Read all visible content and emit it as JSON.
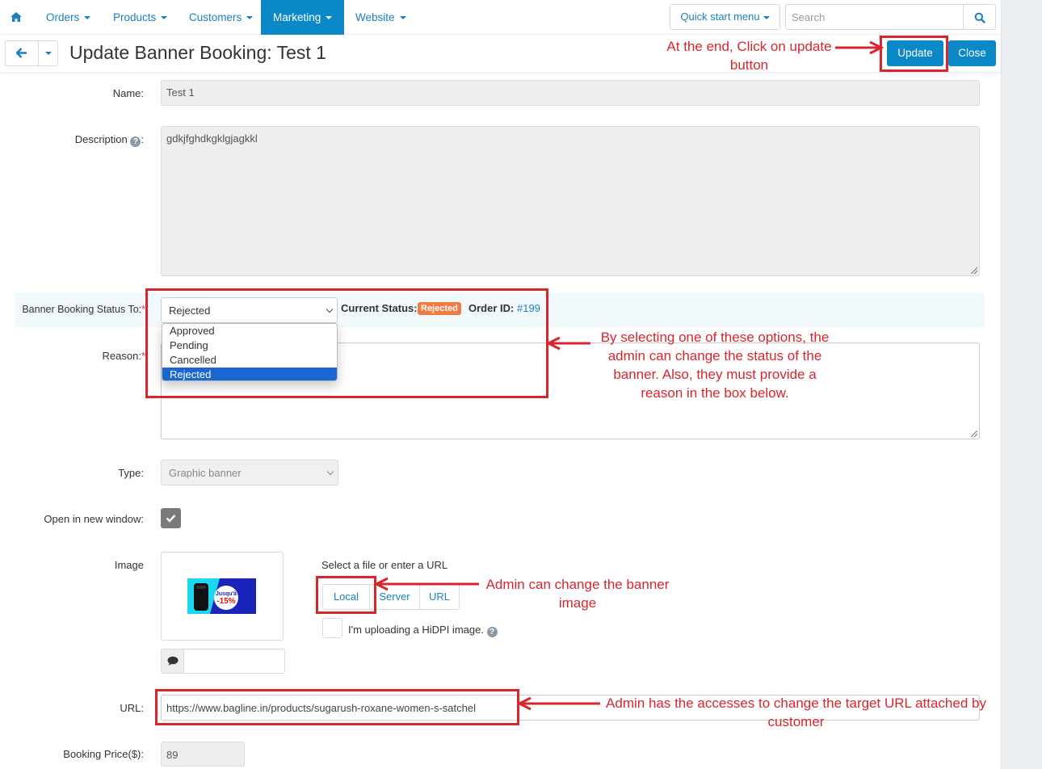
{
  "nav": {
    "items": [
      {
        "label": "Orders"
      },
      {
        "label": "Products"
      },
      {
        "label": "Customers"
      },
      {
        "label": "Marketing",
        "active": true
      },
      {
        "label": "Website"
      }
    ],
    "quick_start_label": "Quick start menu",
    "search_placeholder": "Search"
  },
  "titlebar": {
    "title": "Update Banner Booking: Test 1",
    "update_label": "Update",
    "close_label": "Close"
  },
  "form": {
    "name_label": "Name:",
    "name_value": "Test 1",
    "description_label": "Description",
    "description_value": "gdkjfghdkgklgjagkkl",
    "status_label": "Banner Booking Status To:",
    "status_selected": "Rejected",
    "status_options": [
      "Approved",
      "Pending",
      "Cancelled",
      "Rejected"
    ],
    "current_status_label": "Current Status:",
    "current_status_value": "Rejected",
    "order_id_label": "Order ID:",
    "order_id_value": "#199",
    "reason_label": "Reason:",
    "reason_value": "",
    "type_label": "Type:",
    "type_value": "Graphic banner",
    "open_new_window_label": "Open in new window:",
    "open_new_window_checked": true,
    "image_label": "Image",
    "banner_text_line1": "Jusqu'à",
    "banner_text_line2": "-15%",
    "select_file_label": "Select a file or enter a URL",
    "source_buttons": [
      "Local",
      "Server",
      "URL"
    ],
    "hidpi_label": "I'm uploading a HiDPI image.",
    "url_label": "URL:",
    "url_value": "https://www.bagline.in/products/sugarush-roxane-women-s-satchel",
    "price_label": "Booking Price($):",
    "price_value": "89"
  },
  "annotations": {
    "update": "At the end, Click on update button",
    "status": "By selecting one of these options, the admin can change the status of the banner. Also, they must provide a reason in the box below.",
    "image": "Admin can change the banner image",
    "url": "Admin has the accesses to change the target URL attached by customer"
  },
  "colors": {
    "primary": "#0b88c8",
    "link": "#1b7fc0",
    "badge_rejected": "#f27b43",
    "annotation_red": "#d7262e",
    "dropdown_highlight": "#1a67d2"
  }
}
